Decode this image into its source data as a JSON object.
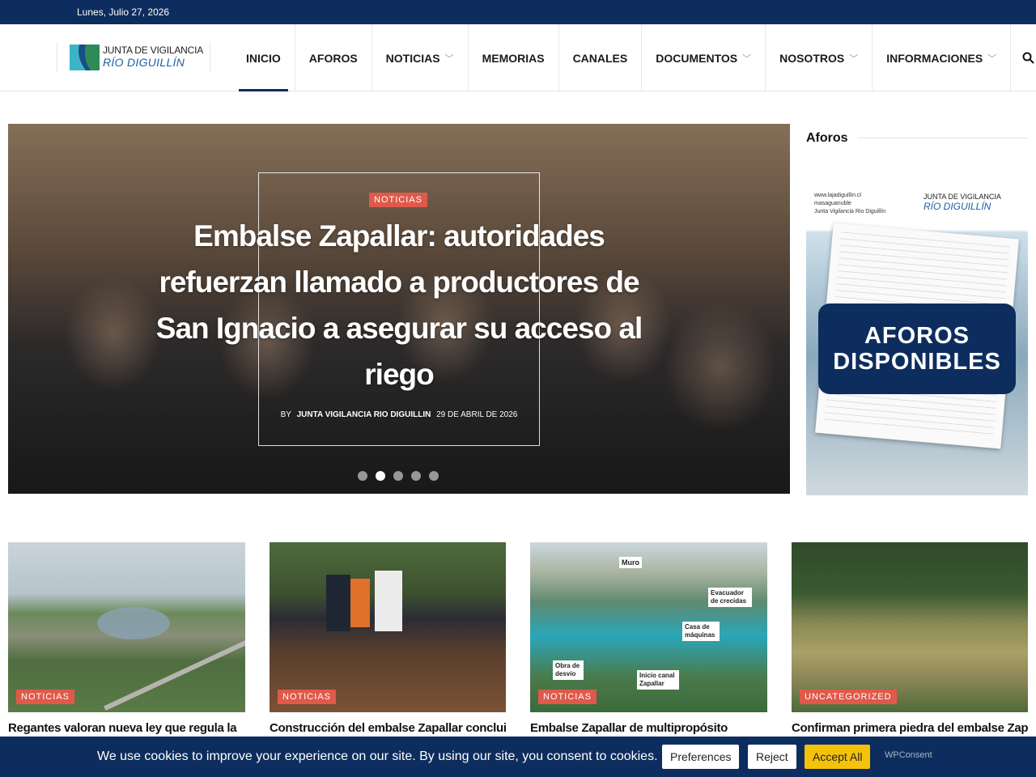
{
  "topbar": {
    "date": "Lunes, Julio 27, 2026"
  },
  "logo": {
    "line1": "JUNTA DE VIGILANCIA",
    "line2": "RÍO DIGUILLÍN"
  },
  "nav": [
    {
      "label": "INICIO"
    },
    {
      "label": "AFOROS"
    },
    {
      "label": "NOTICIAS",
      "has_dropdown": true
    },
    {
      "label": "MEMORIAS"
    },
    {
      "label": "CANALES"
    },
    {
      "label": "DOCUMENTOS",
      "has_dropdown": true
    },
    {
      "label": "NOSOTROS",
      "has_dropdown": true
    },
    {
      "label": "INFORMACIONES",
      "has_dropdown": true
    }
  ],
  "nav_active": "INICIO",
  "hero": {
    "category": "NOTICIAS",
    "title": "Embalse Zapallar: autoridades refuerzan llamado a productores de San Ignacio a asegurar su acceso al riego",
    "by": "BY",
    "author": "JUNTA VIGILANCIA RIO DIGUILLIN",
    "date": "29 DE ABRIL DE 2026",
    "slides_total": 5,
    "slide_active": 2
  },
  "sidebar": {
    "title": "Aforos",
    "promo": {
      "links": [
        "www.lajadiguillin.cl",
        "masaguanuble",
        "Junta Vigilancia Rio Diguillín"
      ],
      "logo_line1": "JUNTA DE VIGILANCIA",
      "logo_line2": "RÍO DIGUILLÍN",
      "cta_line1": "AFOROS",
      "cta_line2": "DISPONIBLES"
    }
  },
  "cards": [
    {
      "category": "NOTICIAS",
      "title": "Regantes valoran nueva ley que regula la"
    },
    {
      "category": "NOTICIAS",
      "title": "Construcción del embalse Zapallar concluiría"
    },
    {
      "category": "NOTICIAS",
      "title": "Embalse Zapallar de multipropósito"
    },
    {
      "category": "UNCATEGORIZED",
      "title": "Confirman primera piedra del embalse Zapallar"
    }
  ],
  "card3_labels": [
    "Muro",
    "Evacuador de crecidas",
    "Casa de máquinas",
    "Obra de desvío",
    "Inicio canal Zapallar"
  ],
  "cookie": {
    "message": "We use cookies to improve your experience on our site. By using our site, you consent to cookies.",
    "preferences": "Preferences",
    "reject": "Reject",
    "accept": "Accept All",
    "brand": "WPConsent"
  },
  "colors": {
    "primary": "#0d2d5e",
    "badge": "#e0594a",
    "accept": "#f5c20a"
  }
}
